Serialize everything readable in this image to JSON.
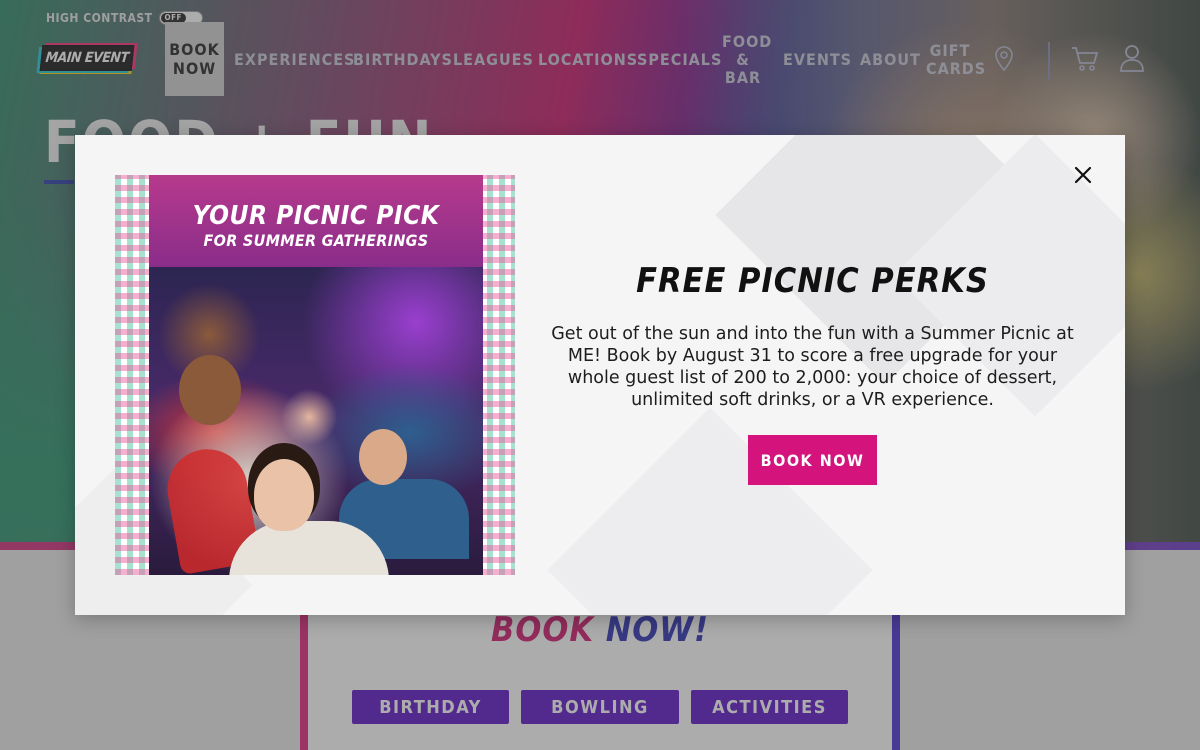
{
  "header": {
    "high_contrast_label": "HIGH CONTRAST",
    "high_contrast_state": "OFF",
    "logo_text": "MAIN EVENT",
    "book_now": "BOOK\nNOW",
    "nav": [
      {
        "label": "EXPERIENCES"
      },
      {
        "label": "BIRTHDAYS"
      },
      {
        "label": "LEAGUES"
      },
      {
        "label": "LOCATIONS"
      },
      {
        "label": "SPECIALS"
      },
      {
        "label": "FOOD\n&\nBAR"
      },
      {
        "label": "EVENTS"
      },
      {
        "label": "ABOUT"
      },
      {
        "label": "GIFT\nCARDS"
      }
    ],
    "icons": [
      "location-pin-icon",
      "cart-icon",
      "user-icon"
    ]
  },
  "hero": {
    "title": "FOOD + FUN"
  },
  "lower": {
    "heading_part1": "BOOK",
    "heading_part2": "NOW!",
    "buttons": [
      {
        "label": "BIRTHDAY"
      },
      {
        "label": "BOWLING"
      },
      {
        "label": "ACTIVITIES"
      }
    ]
  },
  "modal": {
    "promo_headline": "YOUR PICNIC PICK",
    "promo_subheadline": "FOR SUMMER GATHERINGS",
    "title": "FREE PICNIC PERKS",
    "body": "Get out of the sun and into the fun with a Summer Picnic at ME! Book by August 31 to score a free upgrade for your whole guest list of 200 to 2,000: your choice of dessert, unlimited soft drinks, or a VR experience.",
    "cta": "BOOK NOW",
    "close_icon": "close-icon"
  },
  "colors": {
    "brand_pink": "#d4147c",
    "brand_purple": "#5b12c6",
    "heading_blue": "#2a2fb5"
  }
}
